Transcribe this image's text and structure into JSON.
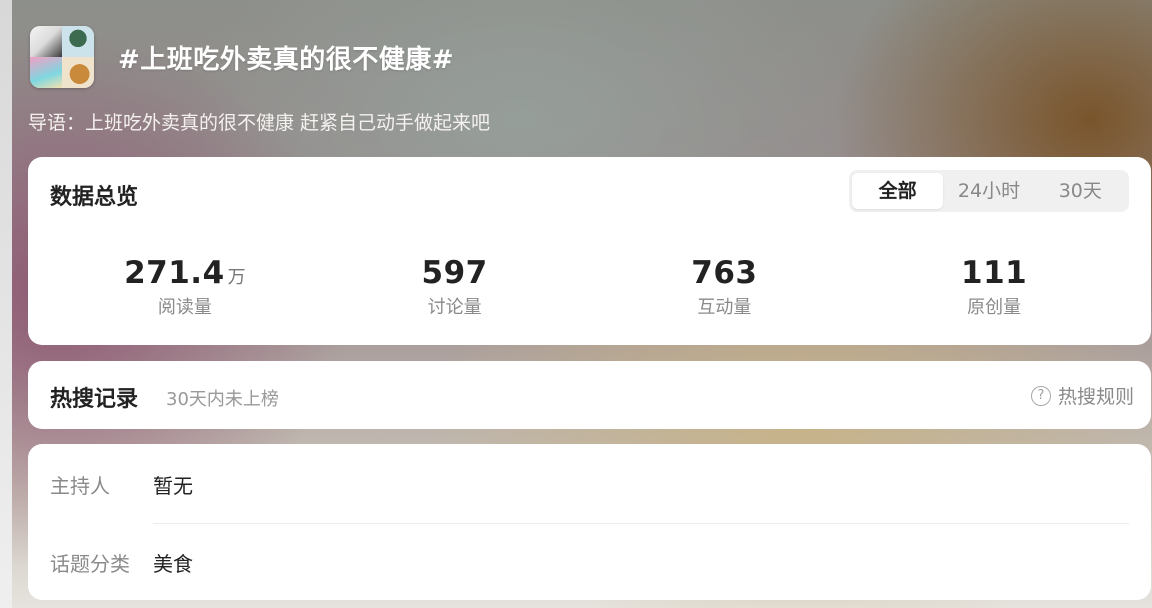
{
  "topic": {
    "title": "#上班吃外卖真的很不健康#",
    "intro": "导语：上班吃外卖真的很不健康 赶紧自己动手做起来吧"
  },
  "overview": {
    "title": "数据总览",
    "tabs": [
      {
        "label": "全部",
        "active": true
      },
      {
        "label": "24小时",
        "active": false
      },
      {
        "label": "30天",
        "active": false
      }
    ],
    "stats": [
      {
        "value": "271.4",
        "unit": "万",
        "label": "阅读量"
      },
      {
        "value": "597",
        "unit": "",
        "label": "讨论量"
      },
      {
        "value": "763",
        "unit": "",
        "label": "互动量"
      },
      {
        "value": "111",
        "unit": "",
        "label": "原创量"
      }
    ]
  },
  "hot_search": {
    "title": "热搜记录",
    "note": "30天内未上榜",
    "rules_label": "热搜规则",
    "help_glyph": "?"
  },
  "info": {
    "host_label": "主持人",
    "host_value": "暂无",
    "category_label": "话题分类",
    "category_value": "美食"
  },
  "colors": {
    "card_bg": "#ffffff",
    "title_text": "#222222",
    "secondary_text": "#8a8a8a",
    "segment_bg": "#f0f0f0"
  },
  "icons": {
    "topic_avatar": "topic-cover-collage",
    "rules_help": "question-circle-icon"
  }
}
